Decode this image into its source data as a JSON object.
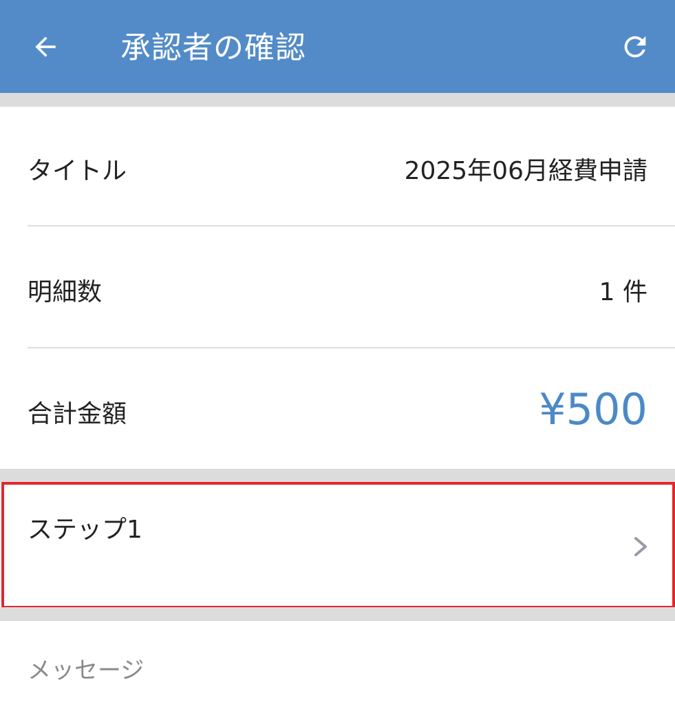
{
  "header": {
    "title": "承認者の確認",
    "back_icon": "arrow-left-icon",
    "refresh_icon": "refresh-icon",
    "bg_color": "#528bc8"
  },
  "summary": {
    "title_label": "タイトル",
    "title_value": "2025年06月経費申請",
    "count_label": "明細数",
    "count_value": "1 件",
    "total_label": "合計金額",
    "total_value": "¥500",
    "total_color": "#4b89c7"
  },
  "steps": [
    {
      "label": "ステップ1",
      "icon": "chevron-right-icon"
    }
  ],
  "message": {
    "label": "メッセージ"
  },
  "highlight_color": "#e3262f"
}
